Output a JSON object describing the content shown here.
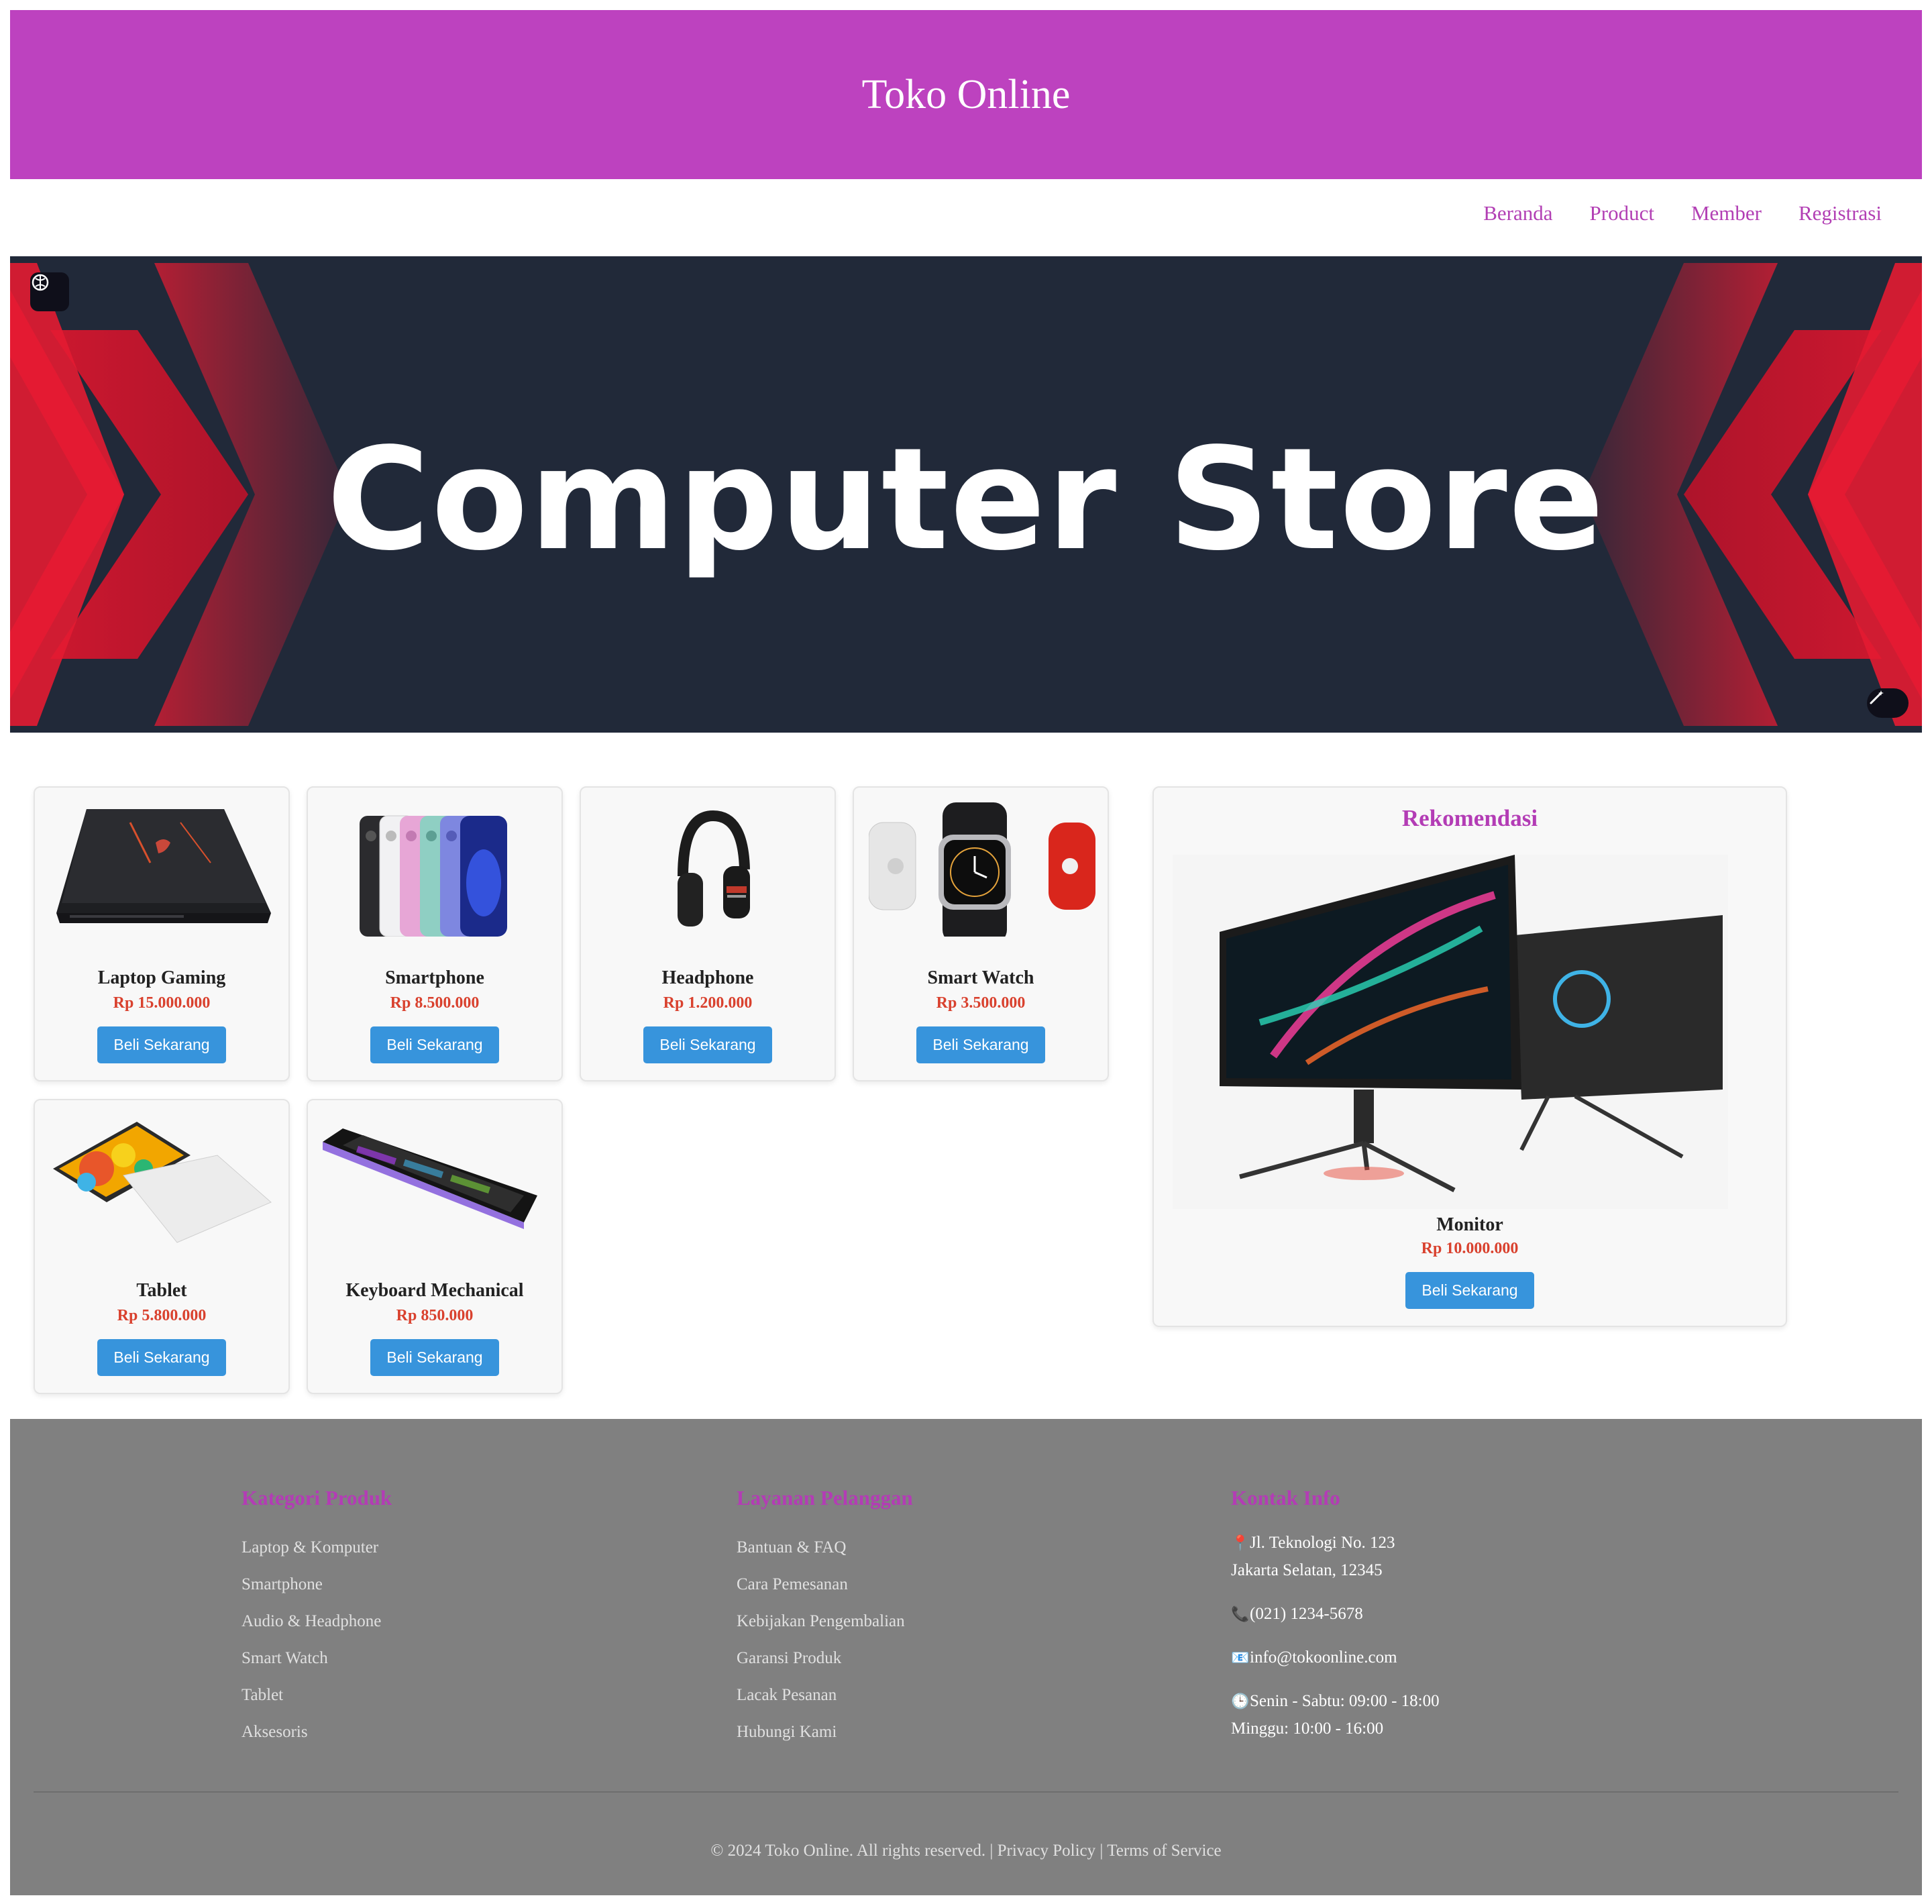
{
  "header": {
    "title": "Toko Online"
  },
  "nav": {
    "items": [
      "Beranda",
      "Product",
      "Member",
      "Registrasi"
    ]
  },
  "banner": {
    "title": "Computer Store"
  },
  "products": [
    {
      "name": "Laptop Gaming",
      "price": "Rp 15.000.000",
      "button": "Beli Sekarang",
      "icon": "laptop-image"
    },
    {
      "name": "Smartphone",
      "price": "Rp 8.500.000",
      "button": "Beli Sekarang",
      "icon": "smartphone-image"
    },
    {
      "name": "Headphone",
      "price": "Rp 1.200.000",
      "button": "Beli Sekarang",
      "icon": "headphone-image"
    },
    {
      "name": "Smart Watch",
      "price": "Rp 3.500.000",
      "button": "Beli Sekarang",
      "icon": "smartwatch-image"
    },
    {
      "name": "Tablet",
      "price": "Rp 5.800.000",
      "button": "Beli Sekarang",
      "icon": "tablet-image"
    },
    {
      "name": "Keyboard Mechanical",
      "price": "Rp 850.000",
      "button": "Beli Sekarang",
      "icon": "keyboard-image"
    }
  ],
  "recommendation": {
    "heading": "Rekomendasi",
    "name": "Monitor",
    "price": "Rp 10.000.000",
    "button": "Beli Sekarang",
    "icon": "monitor-image"
  },
  "footer": {
    "categories": {
      "heading": "Kategori Produk",
      "items": [
        "Laptop & Komputer",
        "Smartphone",
        "Audio & Headphone",
        "Smart Watch",
        "Tablet",
        "Aksesoris"
      ]
    },
    "service": {
      "heading": "Layanan Pelanggan",
      "items": [
        "Bantuan & FAQ",
        "Cara Pemesanan",
        "Kebijakan Pengembalian",
        "Garansi Produk",
        "Lacak Pesanan",
        "Hubungi Kami"
      ]
    },
    "contact": {
      "heading": "Kontak Info",
      "address_line1": "Jl. Teknologi No. 123",
      "address_line2": "Jakarta Selatan, 12345",
      "phone": "(021) 1234-5678",
      "email": "info@tokoonline.com",
      "hours_line1": "Senin - Sabtu: 09:00 - 18:00",
      "hours_line2": "Minggu: 10:00 - 16:00"
    },
    "copyright": "© 2024 Toko Online. All rights reserved. |",
    "privacy": "Privacy Policy",
    "separator": "|",
    "terms": "Terms of Service"
  },
  "colors": {
    "header": "#bd42bf",
    "accent": "#b33cb5",
    "price": "#d9412e",
    "button": "#3794dc",
    "banner_bg": "#212939",
    "banner_red": "#e31b32",
    "footer": "#808080"
  }
}
